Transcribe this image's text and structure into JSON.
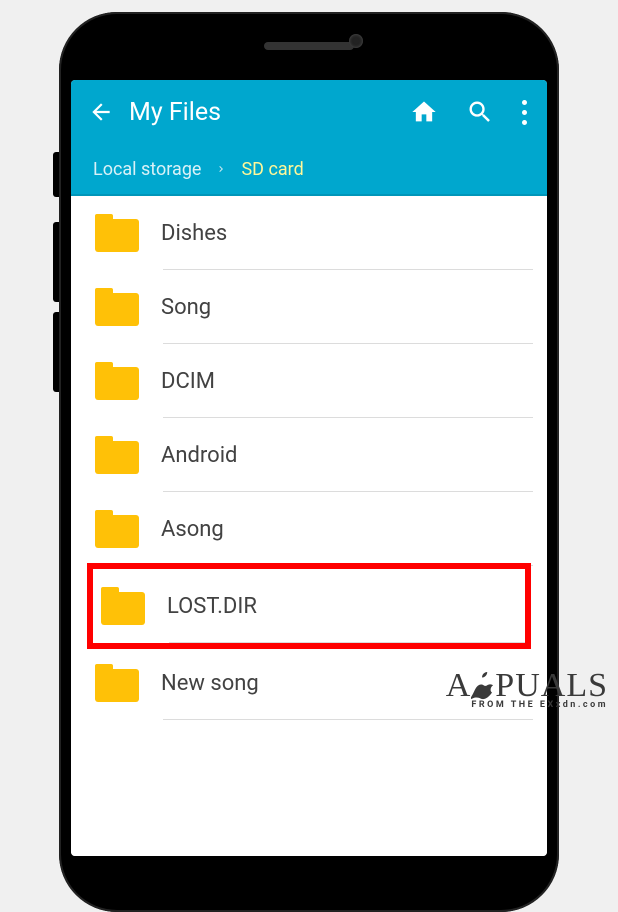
{
  "appBar": {
    "title": "My Files"
  },
  "breadcrumb": {
    "parent": "Local storage",
    "current": "SD card"
  },
  "folders": [
    {
      "name": "Dishes",
      "highlighted": false
    },
    {
      "name": "Song",
      "highlighted": false
    },
    {
      "name": "DCIM",
      "highlighted": false
    },
    {
      "name": "Android",
      "highlighted": false
    },
    {
      "name": "Asong",
      "highlighted": false
    },
    {
      "name": "LOST.DIR",
      "highlighted": true
    },
    {
      "name": "New song",
      "highlighted": false
    }
  ],
  "watermark": {
    "brandLeft": "A",
    "brandRight": "PUALS",
    "subtitlePrefix": "FROM THE EX",
    "subtitleSuffix": "xdn.com"
  }
}
